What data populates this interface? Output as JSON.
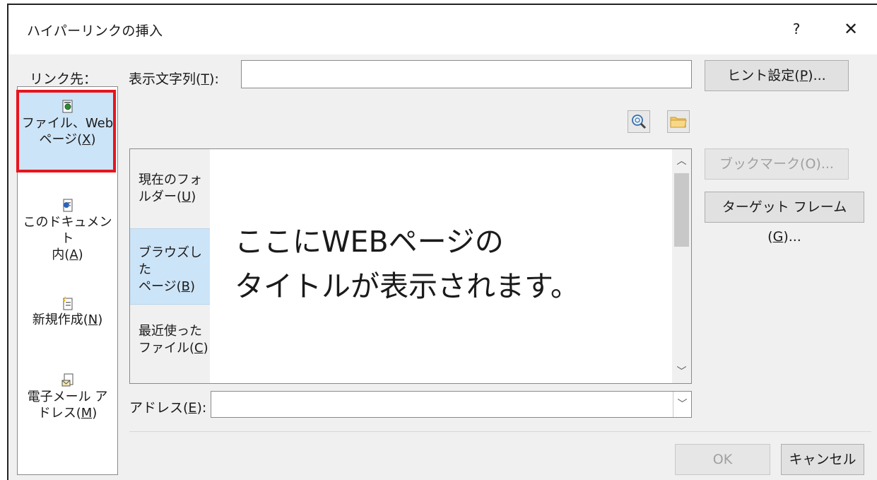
{
  "window": {
    "title": "ハイパーリンクの挿入",
    "help": "?",
    "close": "✕"
  },
  "link_to": {
    "label": "リンク先：",
    "items": [
      {
        "pre": "ファイル、Web",
        "line2_pre": "ページ(",
        "accel": "X",
        "post": ")",
        "icon": "web-page-icon",
        "selected": true
      },
      {
        "pre": "このドキュメント",
        "line2_pre": "内(",
        "accel": "A",
        "post": ")",
        "icon": "document-place-icon",
        "selected": false
      },
      {
        "pre": "",
        "line2_pre": "新規作成(",
        "accel": "N",
        "post": ")",
        "icon": "new-document-icon",
        "selected": false
      },
      {
        "pre": "電子メール ア",
        "line2_pre": "ドレス(",
        "accel": "M",
        "post": ")",
        "icon": "email-icon",
        "selected": false
      }
    ]
  },
  "display_text": {
    "label_pre": "表示文字列(",
    "accel": "T",
    "label_post": "):",
    "value": ""
  },
  "screentip_button": {
    "pre": "ヒント設定(",
    "accel": "P",
    "post": ")..."
  },
  "toolbar": {
    "browse_web_icon": "browse-web-icon",
    "browse_file_icon": "folder-icon"
  },
  "look_in": {
    "tabs": [
      {
        "line1": "現在のフォ",
        "line2_pre": "ルダー(",
        "accel": "U",
        "post": ")",
        "selected": false
      },
      {
        "line1": "ブラウズした",
        "line2_pre": "ページ(",
        "accel": "B",
        "post": ")",
        "selected": true
      },
      {
        "line1": "最近使った",
        "line2_pre": "ファイル(",
        "accel": "C",
        "post": ")",
        "selected": false
      }
    ],
    "overlay_line1": "ここにWEBページの",
    "overlay_line2": "タイトルが表示されます。"
  },
  "bookmark_button": {
    "label": "ブックマーク(O)..."
  },
  "target_frame_button": {
    "pre": "ターゲット フレーム(",
    "accel": "G",
    "post": ")..."
  },
  "address": {
    "label_pre": "アドレス(",
    "accel": "E",
    "label_post": "):",
    "value": ""
  },
  "ok_button": {
    "label": "OK"
  },
  "cancel_button": {
    "label": "キャンセル"
  }
}
